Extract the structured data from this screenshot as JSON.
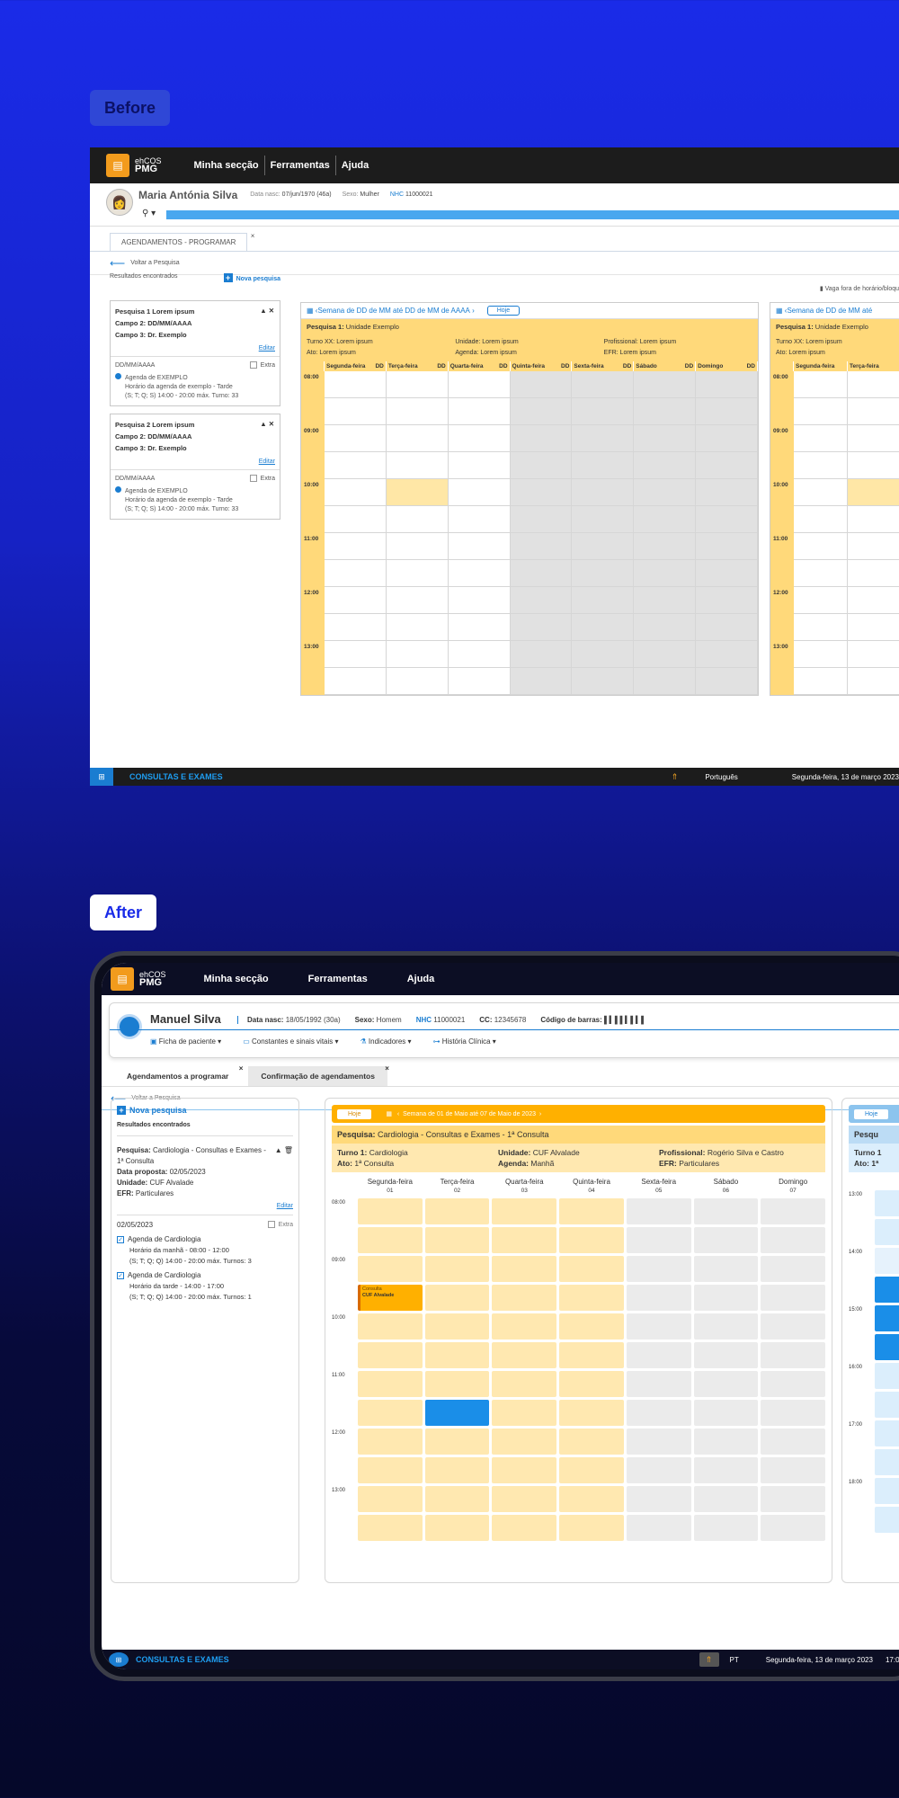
{
  "labels": {
    "before": "Before",
    "after": "After"
  },
  "before": {
    "logo_small": "ehCOS",
    "logo_big": "PMG",
    "menu": [
      "Minha secção",
      "Ferramentas",
      "Ajuda"
    ],
    "patient": {
      "name": "Maria Antónia Silva",
      "dob_label": "Data nasc:",
      "dob": "07/jun/1970 (46a)",
      "sex_label": "Sexo:",
      "sex": "Mulher",
      "nhc_label": "NHC",
      "nhc": "11000021"
    },
    "tab": "AGENDAMENTOS - PROGRAMAR",
    "back": "Voltar a Pesquisa",
    "results": "Resultados encontrados",
    "new_search": "Nova pesquisa",
    "vaga": "Vaga fora de horário/bloqu",
    "cards": [
      {
        "title": "Pesquisa 1 Lorem ipsum",
        "f2": "Campo 2: DD/MM/AAAA",
        "f3": "Campo 3: Dr. Exemplo",
        "edit": "Editar",
        "date": "DD/MM/AAAA",
        "extra": "Extra",
        "agenda": "Agenda de EXEMPLO",
        "sched": "Horário da agenda de exemplo - Tarde",
        "detail": "(S; T; Q; S) 14:00 - 20:00 máx. Turno: 33"
      },
      {
        "title": "Pesquisa 2 Lorem ipsum",
        "f2": "Campo 2: DD/MM/AAAA",
        "f3": "Campo 3: Dr. Exemplo",
        "edit": "Editar",
        "date": "DD/MM/AAAA",
        "extra": "Extra",
        "agenda": "Agenda de EXEMPLO",
        "sched": "Horário da agenda de exemplo - Tarde",
        "detail": "(S; T; Q; S) 14:00 - 20:00 máx. Turno: 33"
      }
    ],
    "cal": {
      "week": "Semana de DD de MM até DD de MM de AAAA",
      "week2": "Semana de DD de MM até",
      "hoje": "Hoje",
      "pesquisa": "Pesquisa 1:",
      "unidade_ex": "Unidade Exemplo",
      "turno": "Turno XX: Lorem ipsum",
      "ato": "Ato: Lorem ipsum",
      "unidade": "Unidade: Lorem ipsum",
      "agenda": "Agenda: Lorem ipsum",
      "prof": "Profissional: Lorem ipsum",
      "efr": "EFR: Lorem ipsum",
      "days": [
        "Segunda-feira",
        "Terça-feira",
        "Quarta-feira",
        "Quinta-feira",
        "Sexta-feira",
        "Sábado",
        "Domingo"
      ],
      "dd": "DD",
      "times": [
        "08:00",
        "09:00",
        "10:00",
        "11:00",
        "12:00",
        "13:00"
      ]
    },
    "status": {
      "title": "CONSULTAS E EXAMES",
      "lang": "Português",
      "date": "Segunda-feira, 13 de março 2023"
    }
  },
  "after": {
    "logo_small": "ehCOS",
    "logo_big": "PMG",
    "menu": [
      "Minha secção",
      "Ferramentas",
      "Ajuda"
    ],
    "patient": {
      "name": "Manuel Silva",
      "dob_label": "Data nasc:",
      "dob": "18/05/1992 (30a)",
      "sex_label": "Sexo:",
      "sex": "Homem",
      "nhc_label": "NHC",
      "nhc": "11000021",
      "cc_label": "CC:",
      "cc": "12345678",
      "barcode_label": "Código de barras:"
    },
    "actions": [
      "Ficha de paciente",
      "Constantes e sinais vitais",
      "Indicadores",
      "História Clínica"
    ],
    "tabs": [
      "Agendamentos a programar",
      "Confirmação de agendamentos"
    ],
    "back": "Voltar a Pesquisa",
    "new_search": "Nova pesquisa",
    "results": "Resultados encontrados",
    "search": {
      "l1": "Pesquisa:",
      "v1": "Cardiologia - Consultas e Exames - 1ª Consulta",
      "l2": "Data proposta:",
      "v2": "02/05/2023",
      "l3": "Unidade:",
      "v3": "CUF Alvalade",
      "l4": "EFR:",
      "v4": "Particulares",
      "edit": "Editar",
      "date": "02/05/2023",
      "extra": "Extra",
      "ag1": "Agenda de Cardiologia",
      "ag1a": "Horário da manhã - 08:00 - 12:00",
      "ag1b": "(S; T; Q; Q) 14:00 - 20:00 máx. Turnos: 3",
      "ag2": "Agenda de Cardiologia",
      "ag2a": "Horário da tarde - 14:00 - 17:00",
      "ag2b": "(S; T; Q; Q) 14:00 - 20:00 máx. Turnos: 1"
    },
    "cal": {
      "hoje": "Hoje",
      "week": "Semana de 01 de Maio até 07 de Maio de 2023",
      "pesquisa": "Pesquisa:",
      "pesquisa_v": "Cardiologia - Consultas e Exames - 1ª Consulta",
      "turno": "Turno 1:",
      "turno_v": "Cardiologia",
      "ato": "Ato:",
      "ato_v": "1ª Consulta",
      "unidade": "Unidade:",
      "unidade_v": "CUF Alvalade",
      "agenda": "Agenda:",
      "agenda_v": "Manhã",
      "prof": "Profissional:",
      "prof_v": "Rogério Silva e Castro",
      "efr": "EFR:",
      "efr_v": "Particulares",
      "days": [
        {
          "n": "Segunda-feira",
          "d": "01"
        },
        {
          "n": "Terça-feira",
          "d": "02"
        },
        {
          "n": "Quarta-feira",
          "d": "03"
        },
        {
          "n": "Quinta-feira",
          "d": "04"
        },
        {
          "n": "Sexta-feira",
          "d": "05"
        },
        {
          "n": "Sábado",
          "d": "06"
        },
        {
          "n": "Domingo",
          "d": "07"
        }
      ],
      "times": [
        "08:00",
        "09:00",
        "10:00",
        "11:00",
        "12:00",
        "13:00"
      ],
      "cons": "Consulta",
      "cons_loc": "CUF Alvalade",
      "cal2_p": "Pesqu",
      "cal2_t": "Turno 1",
      "cal2_a": "Ato: 1ª",
      "times2": [
        "13:00",
        "14:00",
        "15:00",
        "16:00",
        "17:00",
        "18:00"
      ]
    },
    "status": {
      "title": "CONSULTAS E EXAMES",
      "lang": "PT",
      "date": "Segunda-feira, 13 de março 2023",
      "time": "17:00"
    }
  },
  "colors": {
    "accent": "#1a7dd1",
    "yellow": "#ffd97a",
    "orange": "#ffb000",
    "bg": "#1a2be8"
  }
}
